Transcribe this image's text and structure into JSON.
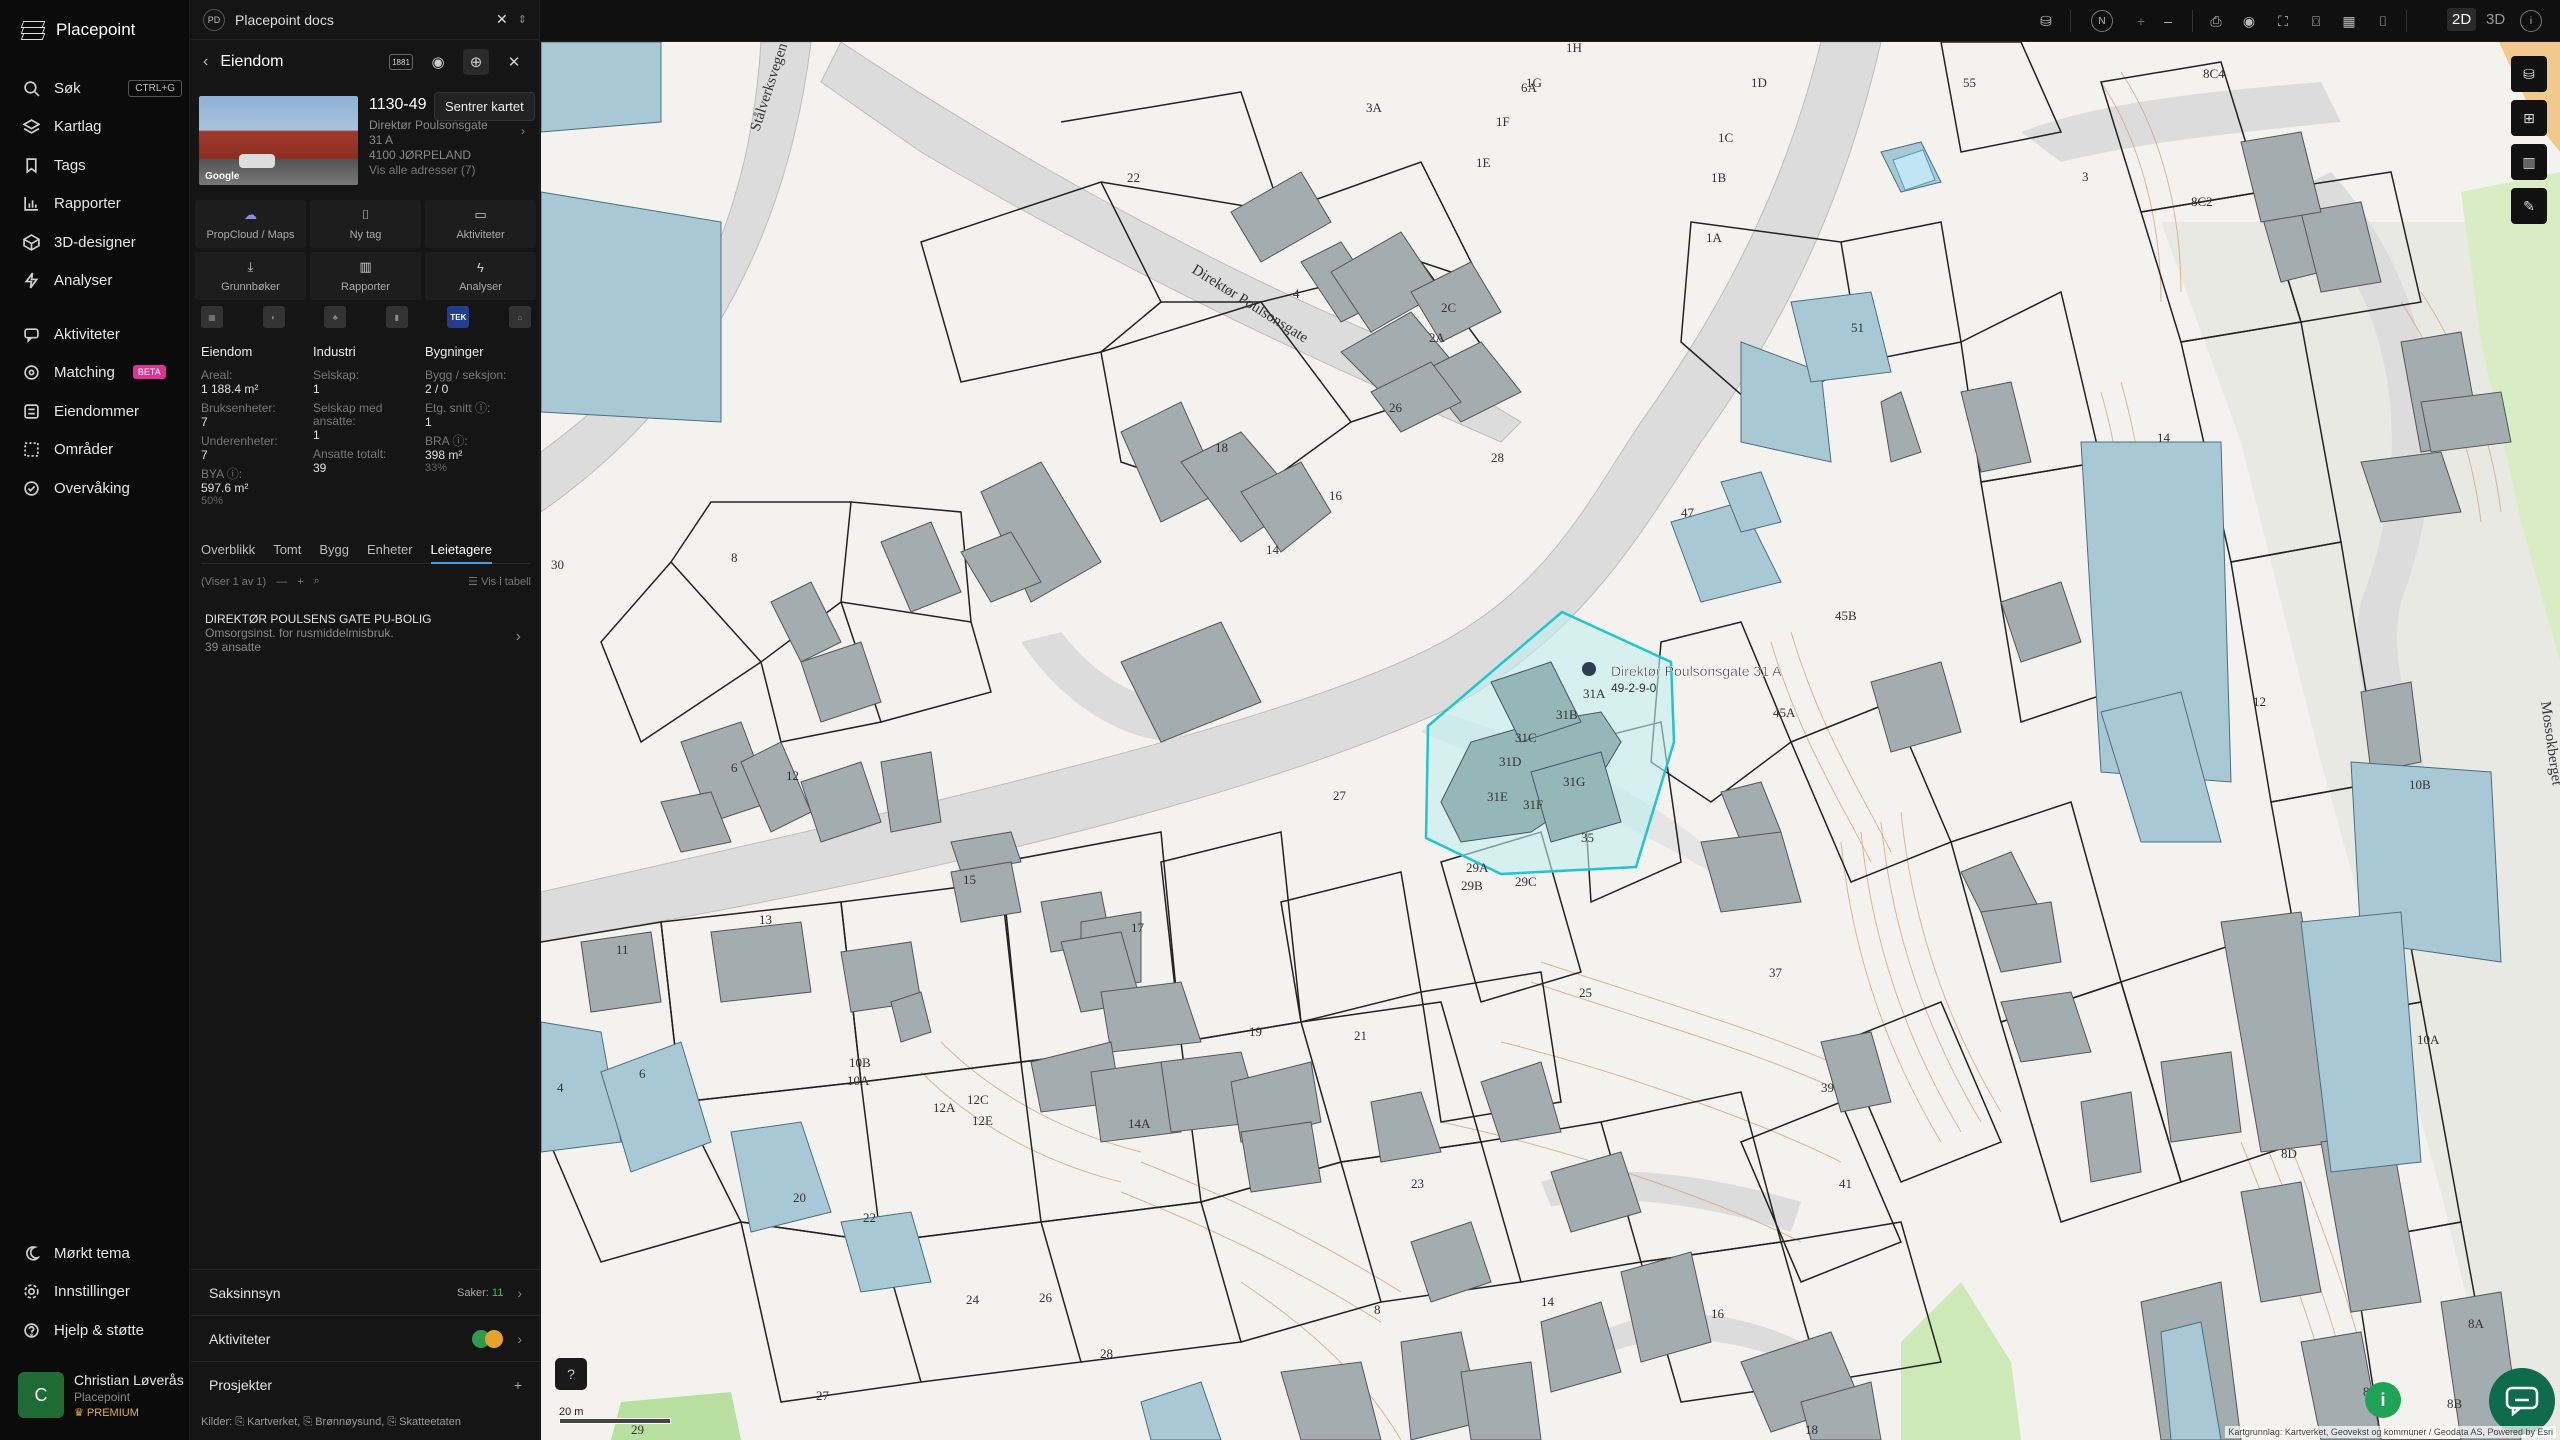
{
  "brand": {
    "name": "Placepoint"
  },
  "nav": {
    "items": [
      {
        "label": "Søk",
        "icon": "search-icon",
        "shortcut": "CTRL+G"
      },
      {
        "label": "Kartlag",
        "icon": "layers-icon"
      },
      {
        "label": "Tags",
        "icon": "bookmark-icon"
      },
      {
        "label": "Rapporter",
        "icon": "chart-icon"
      },
      {
        "label": "3D-designer",
        "icon": "cube-icon"
      },
      {
        "label": "Analyser",
        "icon": "bolt-icon"
      },
      {
        "label": "Aktiviteter",
        "icon": "chat-icon"
      },
      {
        "label": "Matching",
        "icon": "target-icon",
        "badge": "BETA"
      },
      {
        "label": "Eiendommer",
        "icon": "list-icon"
      },
      {
        "label": "Områder",
        "icon": "area-icon"
      },
      {
        "label": "Overvåking",
        "icon": "check-circle-icon"
      }
    ],
    "bottom": [
      {
        "label": "Mørkt tema",
        "icon": "moon-icon"
      },
      {
        "label": "Innstillinger",
        "icon": "gear-icon"
      },
      {
        "label": "Hjelp & støtte",
        "icon": "help-icon"
      }
    ]
  },
  "user": {
    "initial": "C",
    "name": "Christian Løverås",
    "org": "Placepoint",
    "plan": "PREMIUM"
  },
  "docs": {
    "badge": "PD",
    "title": "Placepoint docs"
  },
  "panel": {
    "title": "Eiendom",
    "tooltip": "Sentrer kartet",
    "property": {
      "id": "1130-49",
      "street": "Direktør Poulsonsgate",
      "number": "31 A",
      "postal": "4100 JØRPELAND",
      "all_addresses": "Vis alle adresser (7)",
      "photo_credit": "Google"
    },
    "actions": [
      {
        "label": "PropCloud / Maps",
        "icon": "cloud-icon"
      },
      {
        "label": "Ny tag",
        "icon": "bookmark-icon"
      },
      {
        "label": "Aktiviteter",
        "icon": "chat-icon"
      },
      {
        "label": "Grunnbøker",
        "icon": "download-icon"
      },
      {
        "label": "Rapporter",
        "icon": "chart-icon"
      },
      {
        "label": "Analyser",
        "icon": "bolt-icon"
      }
    ],
    "sources": [
      "matrikkel-icon",
      "globe-icon",
      "factory-icon",
      "signal-icon",
      "TEK",
      "home-icon"
    ],
    "stats": {
      "eiendom": {
        "title": "Eiendom",
        "areal_label": "Areal:",
        "areal_value": "1 188.4 m²",
        "bruks_label": "Bruksenheter:",
        "bruks_value": "7",
        "under_label": "Underenheter:",
        "under_value": "7",
        "bya_label": "BYA ⓘ:",
        "bya_value": "597.6 m²",
        "bya_pct": "50%"
      },
      "industri": {
        "title": "Industri",
        "selskap_label": "Selskap:",
        "selskap_value": "1",
        "med_label": "Selskap med ansatte:",
        "med_value": "1",
        "ansatte_label": "Ansatte totalt:",
        "ansatte_value": "39"
      },
      "bygninger": {
        "title": "Bygninger",
        "bygg_label": "Bygg / seksjon:",
        "bygg_value": "2 / 0",
        "etg_label": "Etg. snitt ⓘ:",
        "etg_value": "1",
        "bra_label": "BRA ⓘ:",
        "bra_value": "398 m²",
        "bra_pct": "33%"
      }
    },
    "tabs": [
      "Overblikk",
      "Tomt",
      "Bygg",
      "Enheter",
      "Leietagere"
    ],
    "active_tab": "Leietagere",
    "list_info": "(Viser 1 av 1)",
    "table_link": "Vis i tabell",
    "tenant": {
      "name": "DIREKTØR POULSENS GATE PU-BOLIG",
      "desc": "Omsorgsinst. for rusmiddelmisbruk.",
      "employees": "39 ansatte"
    },
    "sections": {
      "saksinnsyn": "Saksinnsyn",
      "saker_label": "Saker:",
      "saker_count": "11",
      "aktiviteter": "Aktiviteter",
      "prosjekter": "Prosjekter"
    },
    "clients": "Kilder: ⎘ Kartverket, ⎘ Brønnøysund, ⎘ Skatteetaten"
  },
  "topbar": {
    "north": "N",
    "modes": [
      "2D",
      "3D"
    ],
    "active_mode": "2D"
  },
  "map": {
    "selected_label": "Direktør Poulsonsgate 31 A",
    "selected_sub": "49-2-9-0",
    "street_names": [
      "Direktør Poulsonsgate",
      "Stålverksvegen",
      "Mossokberget"
    ],
    "house_numbers": [
      "22",
      "18",
      "16",
      "26",
      "28",
      "2A",
      "2C",
      "4",
      "1A",
      "1B",
      "1C",
      "1D",
      "1E",
      "1F",
      "1G",
      "1H",
      "3A",
      "6A",
      "6",
      "8",
      "10",
      "12",
      "13",
      "14",
      "15",
      "17",
      "19",
      "20",
      "21",
      "22",
      "23",
      "24",
      "25",
      "26",
      "27",
      "28",
      "29A",
      "29B",
      "29C",
      "31A",
      "31B",
      "31C",
      "31D",
      "31E",
      "31F",
      "31G",
      "35",
      "37",
      "39",
      "41",
      "45A",
      "45B",
      "47",
      "51",
      "55",
      "3",
      "8A",
      "8B",
      "8C",
      "8D",
      "8E",
      "10A",
      "10B",
      "12A",
      "12C",
      "12E",
      "14A",
      "16",
      "30",
      "11",
      "29",
      "B6A",
      "B6.2"
    ],
    "scale_label": "20 m",
    "attribution": "Kartgrunnlag: Kartverket, Geovekst og kommuner / Geodata AS, Powered by Esri"
  }
}
